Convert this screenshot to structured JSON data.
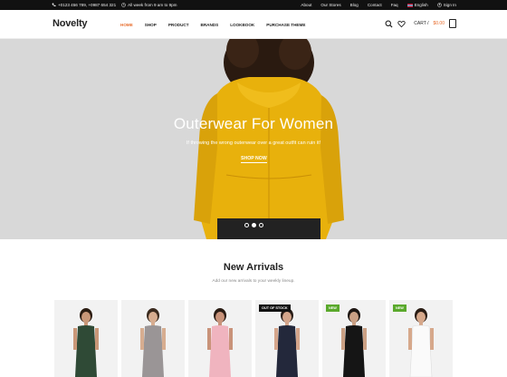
{
  "topbar": {
    "phone": "+0123 456 789, +0987 654 321",
    "hours": "All week from 9 am to 9pm",
    "links": [
      "About",
      "Our Stores",
      "Blog",
      "Contact",
      "Faq"
    ],
    "language": "English",
    "signin": "Sign In"
  },
  "header": {
    "logo": "Novelty",
    "nav": [
      "HOME",
      "SHOP",
      "PRODUCT",
      "BRANDS",
      "LOOKBOOK",
      "PURCHASE THEME"
    ],
    "cart_label": "CART /",
    "cart_amount": "$0.00"
  },
  "hero": {
    "title": "Outerwear For Women",
    "subtitle": "If throwing the wrong outerwear over a great outfit can ruin it!",
    "button": "SHOP NOW"
  },
  "arrivals": {
    "title": "New Arrivals",
    "subtitle": "Add our new arrivals to your weekly lineup.",
    "products": [
      {
        "badge": "",
        "dress": "#2f4a36",
        "skin": "#c99778",
        "hair": "#2b1c12"
      },
      {
        "badge": "",
        "dress": "#9a9596",
        "skin": "#d7ad90",
        "hair": "#3a2a1e"
      },
      {
        "badge": "",
        "dress": "#f0b4bf",
        "skin": "#c9937a",
        "hair": "#2a1c14"
      },
      {
        "badge": "OUT OF STOCK",
        "dress": "#23283b",
        "skin": "#d4a58b",
        "hair": "#2a1e18"
      },
      {
        "badge": "NEW",
        "dress": "#151515",
        "skin": "#caa084",
        "hair": "#1d1612"
      },
      {
        "badge": "NEW",
        "dress": "#fafafa",
        "skin": "#d6a88b",
        "hair": "#2a1d15"
      }
    ]
  },
  "colors": {
    "accent": "#e86c2b",
    "new_badge": "#5aa92c",
    "topbar": "#111111",
    "hero_bg": "#d8d8d8",
    "jacket": "#e8b10c"
  }
}
